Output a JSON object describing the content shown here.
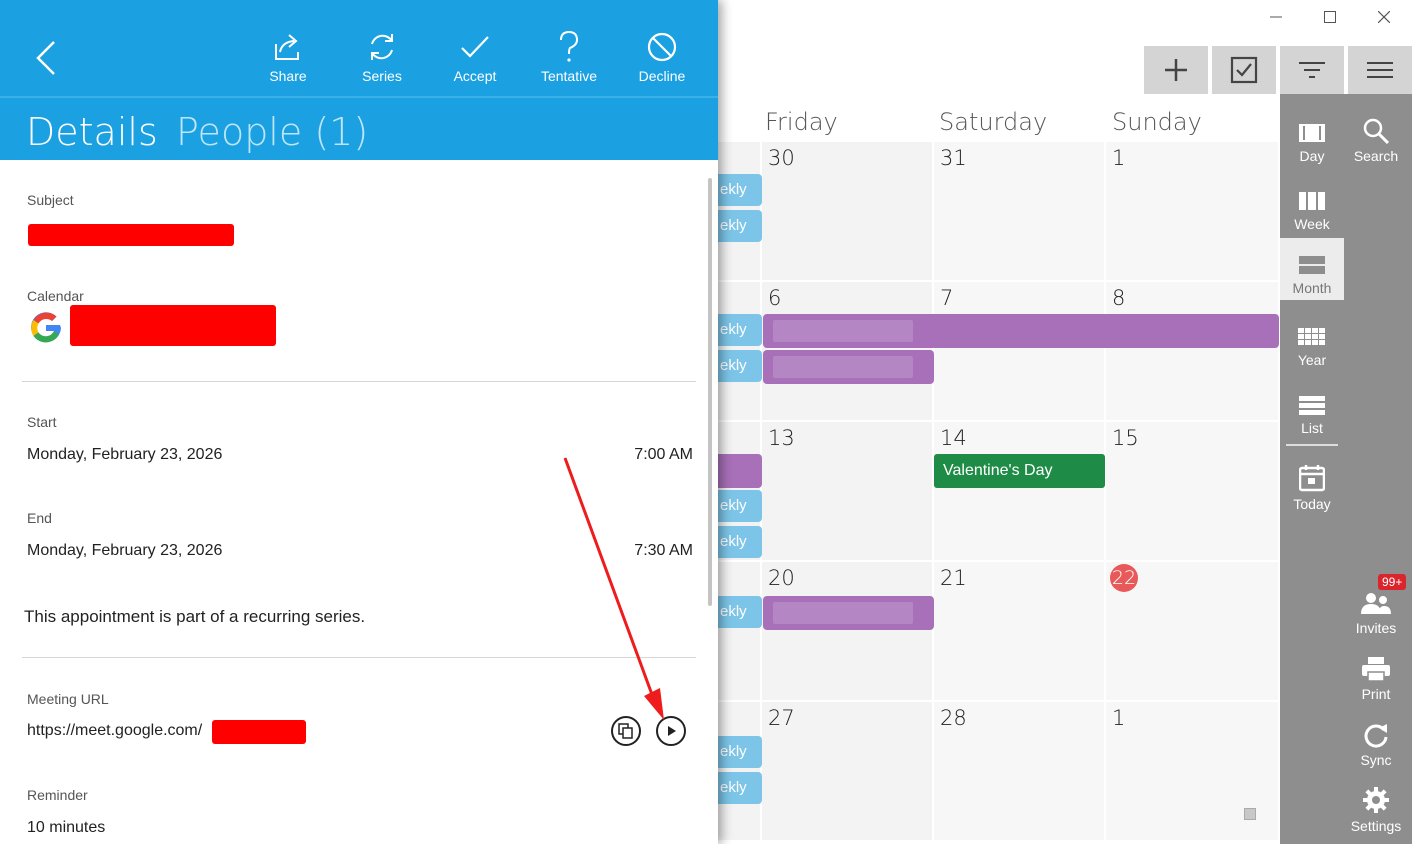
{
  "calendar": {
    "days": [
      "Friday",
      "Saturday",
      "Sunday"
    ],
    "weeks": [
      {
        "nums": [
          "30",
          "31",
          "1"
        ]
      },
      {
        "nums": [
          "6",
          "7",
          "8"
        ]
      },
      {
        "nums": [
          "13",
          "14",
          "15"
        ]
      },
      {
        "nums": [
          "20",
          "21",
          "22"
        ]
      },
      {
        "nums": [
          "27",
          "28",
          "1"
        ]
      }
    ],
    "today_index": {
      "week": 3,
      "day": 2
    },
    "weekly_label": "ekly",
    "holiday": "Valentine's Day",
    "colors": {
      "weekly": "#7cc5e8",
      "purple": "#a870b8",
      "holiday": "#1e8c46",
      "today": "#e85a5a",
      "rail": "#8e8e8e"
    }
  },
  "window_controls": [
    "minimize-icon",
    "maximize-icon",
    "close-icon"
  ],
  "toolbar": {
    "add": "plus-icon",
    "tasks": "checkbox-icon",
    "filter": "filter-icon",
    "menu": "hamburger-icon"
  },
  "rail": {
    "day": "Day",
    "week": "Week",
    "month": "Month",
    "year": "Year",
    "list": "List",
    "today": "Today",
    "search": "Search",
    "invites": "Invites",
    "invites_badge": "99+",
    "print": "Print",
    "sync": "Sync",
    "settings": "Settings"
  },
  "overlay": {
    "actions": {
      "share": "Share",
      "series": "Series",
      "accept": "Accept",
      "tentative": "Tentative",
      "decline": "Decline"
    },
    "tabs": {
      "details": "Details",
      "people": "People (1)"
    },
    "subject_label": "Subject",
    "calendar_label": "Calendar",
    "start_label": "Start",
    "start_date": "Monday, February 23, 2026",
    "start_time": "7:00 AM",
    "end_label": "End",
    "end_date": "Monday, February 23, 2026",
    "end_time": "7:30 AM",
    "recurring_note": "This appointment is part of a recurring series.",
    "meeting_url_label": "Meeting URL",
    "meeting_url": "https://meet.google.com/",
    "reminder_label": "Reminder",
    "reminder_value": "10 minutes",
    "accent": "#1ba1e2",
    "redaction": "#ff0000"
  }
}
